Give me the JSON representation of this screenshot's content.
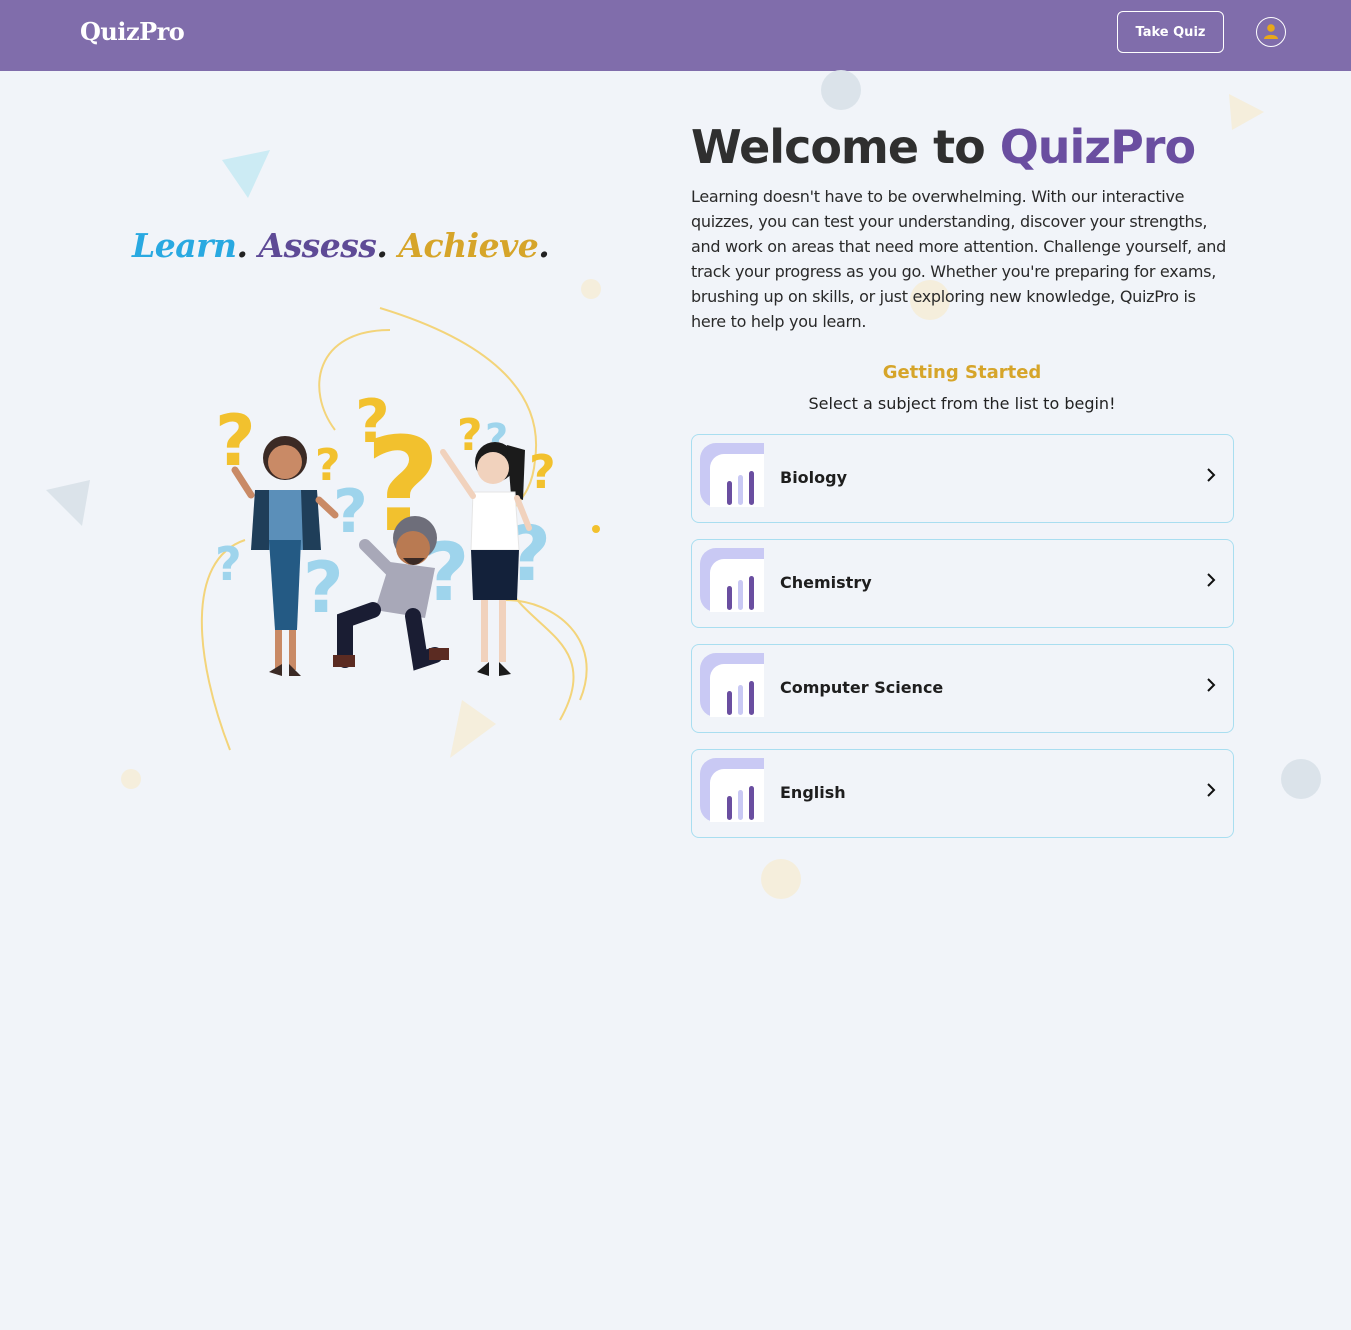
{
  "header": {
    "brand": "QuizPro",
    "take_quiz_label": "Take Quiz",
    "profile_icon": "user-icon"
  },
  "hero": {
    "tagline": {
      "word1": "Learn",
      "word2": "Assess",
      "word3": "Achieve",
      "dot": "."
    },
    "illustration": "people-with-question-marks-illustration"
  },
  "welcome": {
    "prefix": "Welcome to ",
    "brand": "QuizPro",
    "intro": "Learning doesn't have to be overwhelming. With our interactive quizzes, you can test your understanding, discover your strengths, and work on areas that need more attention. Challenge yourself, and track your progress as you go. Whether you're preparing for exams, brushing up on skills, or just exploring new knowledge, QuizPro is here to help you learn."
  },
  "getting_started": {
    "title": "Getting Started",
    "subtitle": "Select a subject from the list to begin!"
  },
  "subjects": [
    {
      "label": "Biology",
      "icon": "bar-chart-icon"
    },
    {
      "label": "Chemistry",
      "icon": "bar-chart-icon"
    },
    {
      "label": "Computer Science",
      "icon": "bar-chart-icon"
    },
    {
      "label": "English",
      "icon": "bar-chart-icon"
    }
  ],
  "colors": {
    "header_bg": "#806dab",
    "brand_purple": "#6a4ea0",
    "accent_gold": "#d6a52a",
    "accent_blue": "#29a9e1",
    "card_border": "#a9def0"
  }
}
